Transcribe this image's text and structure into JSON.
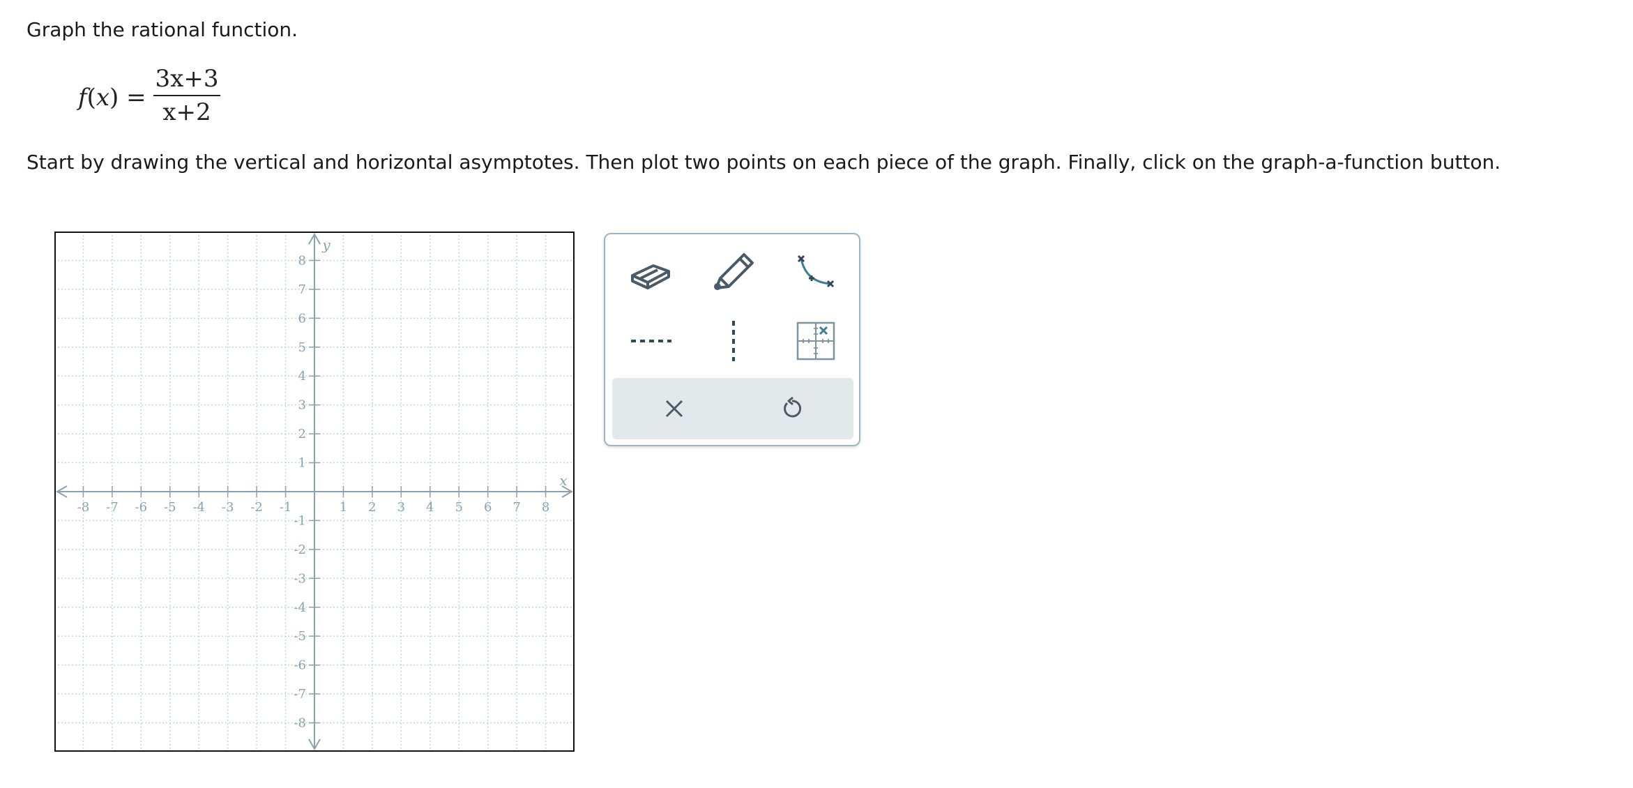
{
  "prompt": "Graph the rational function.",
  "formula": {
    "function_name": "f",
    "variable": "x",
    "numerator": "3x+3",
    "denominator": "x+2"
  },
  "instructions": "Start by drawing the vertical and horizontal asymptotes. Then plot two points on each piece of the graph. Finally, click on the graph-a-function button.",
  "graph": {
    "x_axis_label": "x",
    "y_axis_label": "y",
    "x_range": [
      -9,
      9
    ],
    "y_range": [
      -9,
      9
    ],
    "x_tick_labels": [
      "-8",
      "-7",
      "-6",
      "-5",
      "-4",
      "-3",
      "-2",
      "-1",
      "1",
      "2",
      "3",
      "4",
      "5",
      "6",
      "7",
      "8"
    ],
    "y_tick_labels": [
      "8",
      "7",
      "6",
      "5",
      "4",
      "3",
      "2",
      "1",
      "-1",
      "-2",
      "-3",
      "-4",
      "-5",
      "-6",
      "-7",
      "-8"
    ],
    "grid": true,
    "axis_color": "#8aa2b0",
    "grid_color": "#c9d3da"
  },
  "toolbar": {
    "tools": [
      {
        "name": "eraser-tool",
        "icon": "eraser-icon"
      },
      {
        "name": "pencil-tool",
        "icon": "pencil-icon"
      },
      {
        "name": "graph-a-function-tool",
        "icon": "function-curve-icon"
      },
      {
        "name": "horizontal-asymptote-tool",
        "icon": "horizontal-dashed-line-icon"
      },
      {
        "name": "vertical-asymptote-tool",
        "icon": "vertical-dashed-line-icon"
      },
      {
        "name": "plot-point-tool",
        "icon": "grid-point-icon"
      }
    ],
    "actions": [
      {
        "name": "clear-button",
        "icon": "close-icon"
      },
      {
        "name": "undo-button",
        "icon": "undo-icon"
      }
    ],
    "accent_color": "#3d7f97",
    "icon_color": "#4a5a66"
  }
}
